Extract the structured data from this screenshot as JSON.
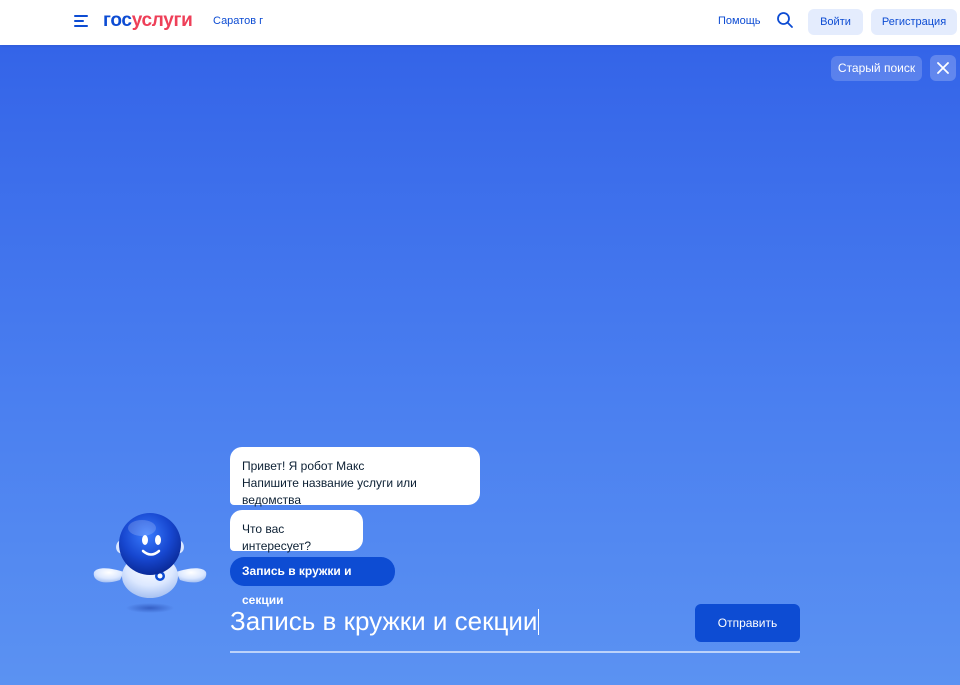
{
  "header": {
    "logo_part1": "гос",
    "logo_part2": "услуги",
    "region": "Саратов г",
    "help": "Помощь",
    "login_label": "Войти",
    "register_label": "Регистрация"
  },
  "main": {
    "old_search_label": "Старый поиск",
    "chat": {
      "greeting_line1": "Привет! Я робот Макс",
      "greeting_line2": "Напишите название услуги или ведомства",
      "question": "Что вас интересует?",
      "suggestion_chip": "Запись в кружки и секции"
    },
    "input_value": "Запись в кружки и секции",
    "send_label": "Отправить"
  },
  "icons": {
    "menu": "menu-icon",
    "search": "search-icon",
    "close": "close-icon",
    "robot": "robot-max-icon"
  },
  "colors": {
    "brand_blue": "#0d4cd3",
    "brand_red": "#ee3f58",
    "gradient_top": "#3464e8",
    "gradient_bottom": "#5b92f2"
  }
}
